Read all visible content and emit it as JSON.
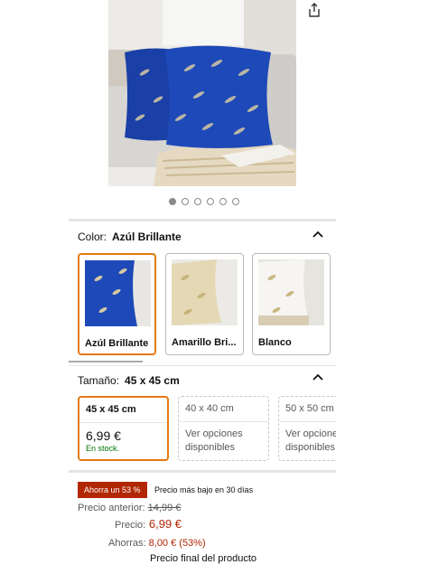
{
  "gallery": {
    "dots_total": 6,
    "active_index": 0
  },
  "color": {
    "label": "Color:",
    "value": "Azúl Brillante",
    "options": [
      {
        "label": "Azúl Brillante",
        "selected": true
      },
      {
        "label": "Amarillo Bri...",
        "selected": false
      },
      {
        "label": "Blanco",
        "selected": false
      }
    ]
  },
  "size": {
    "label": "Tamaño:",
    "value": "45 x 45 cm",
    "options": [
      {
        "label": "45 x 45 cm",
        "price": "6,99 €",
        "stock": "En stock.",
        "selected": true
      },
      {
        "label": "40 x 40 cm",
        "line1": "Ver opciones",
        "line2": "disponibles",
        "selected": false
      },
      {
        "label": "50 x 50 cm",
        "line1": "Ver opcione",
        "line2": "disponibles",
        "selected": false
      }
    ]
  },
  "pricing": {
    "badge": "Ahorra un 53 %",
    "lowest_note": "Precio más bajo en 30 días",
    "previous_label": "Precio anterior:",
    "previous_value": "14,99 €",
    "price_label": "Precio:",
    "price_value": "6,99 €",
    "savings_label": "Ahorras:",
    "savings_value": "8,00 € (53%)",
    "final_note": "Precio final del producto"
  },
  "colors": {
    "accent": "#e47911",
    "price_red": "#b12704",
    "stock_green": "#007600"
  },
  "icons": [
    "share-icon",
    "chevron-up-icon"
  ]
}
